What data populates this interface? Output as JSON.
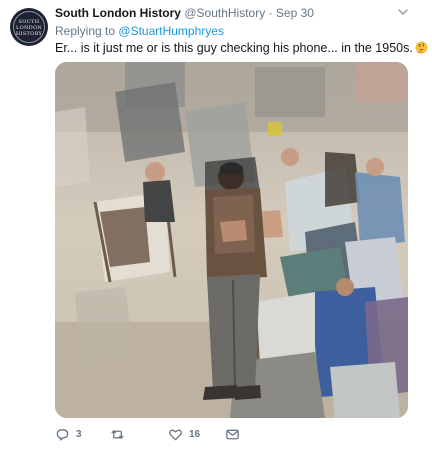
{
  "tweet": {
    "avatar_lines": [
      "SOUTH",
      "LONDON",
      "HISTORY"
    ],
    "display_name": "South London History",
    "handle": "@SouthHistory",
    "separator": "·",
    "timestamp": "Sep 30",
    "reply_prefix": "Replying to",
    "reply_mention": "@StuartHumphryes",
    "text": "Er... is it just me or is this guy checking his phone... in the 1950s.",
    "emoji": "thinking-face-icon"
  },
  "actions": {
    "reply_count": "3",
    "retweet_count": "",
    "like_count": "16"
  },
  "colors": {
    "link": "#1b95e0",
    "muted": "#657786",
    "text": "#14171a"
  }
}
